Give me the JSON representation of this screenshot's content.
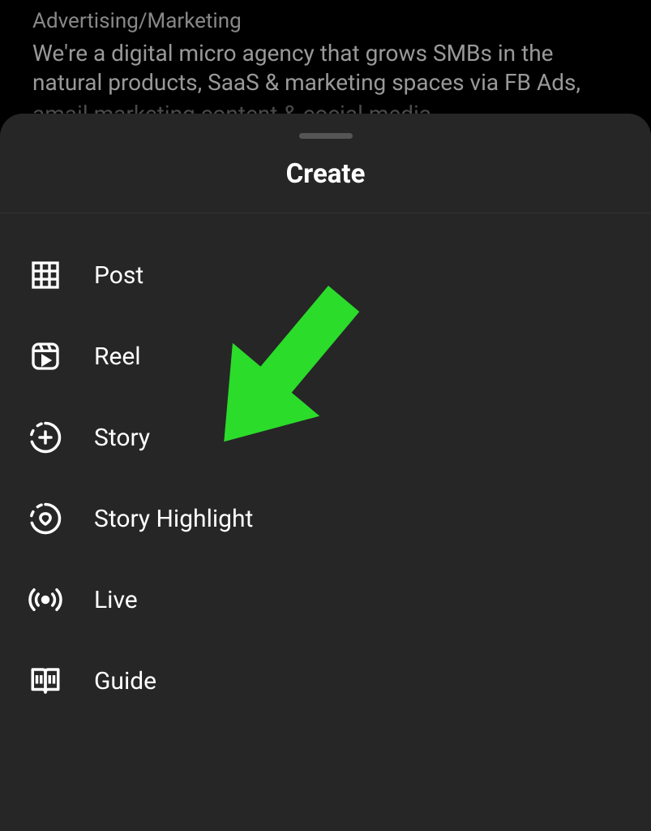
{
  "background": {
    "category": "Advertising/Marketing",
    "description_line1": "We're a digital micro agency that grows SMBs in the",
    "description_line2": "natural products, SaaS & marketing spaces via FB Ads,",
    "description_faded": "amail marketing content & cocial media"
  },
  "sheet": {
    "title": "Create",
    "items": [
      {
        "label": "Post"
      },
      {
        "label": "Reel"
      },
      {
        "label": "Story"
      },
      {
        "label": "Story Highlight"
      },
      {
        "label": "Live"
      },
      {
        "label": "Guide"
      }
    ]
  },
  "annotation": {
    "arrow_color": "#2bdc2b"
  }
}
